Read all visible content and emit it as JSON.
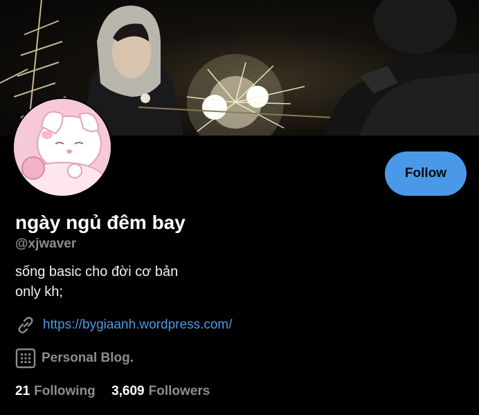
{
  "profile": {
    "display_name": "ngày ngủ đêm bay",
    "handle": "@xjwaver",
    "bio_lines": [
      "sống basic cho đời cơ bản",
      "only kh;"
    ],
    "website": "https://bygiaanh.wordpress.com/",
    "category": "Personal Blog.",
    "following_count": "21",
    "following_label": "Following",
    "followers_count": "3,609",
    "followers_label": "Followers"
  },
  "actions": {
    "follow_label": "Follow"
  },
  "icons": {
    "website": "link-icon",
    "category": "grid-icon"
  },
  "colors": {
    "background": "#000000",
    "accent": "#4a99e9",
    "secondary_text": "#8a8d91"
  }
}
